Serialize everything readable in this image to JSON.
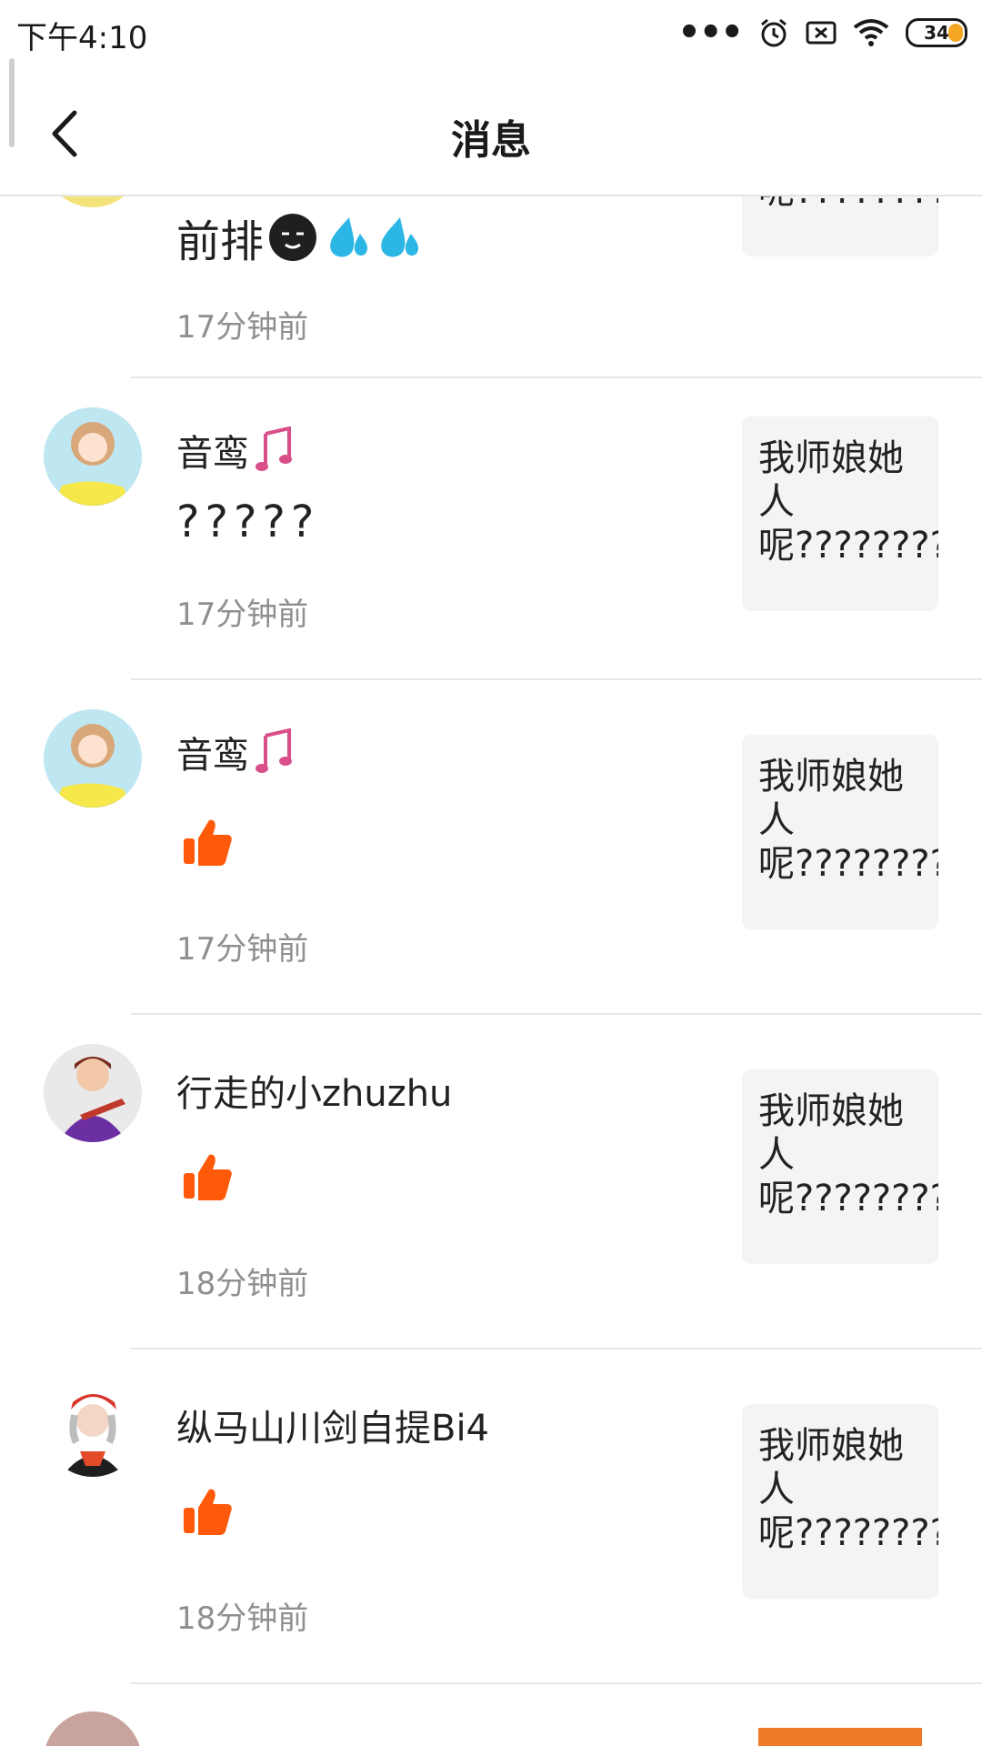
{
  "status_bar": {
    "time": "下午4:10",
    "battery": "34",
    "icons": [
      "more-dots-icon",
      "alarm-icon",
      "sim-off-icon",
      "wifi-icon",
      "battery-icon"
    ]
  },
  "header": {
    "title": "消息",
    "back_icon": "chevron-left-icon"
  },
  "colors": {
    "like": "#ff5a0a",
    "time_text": "#8f8f8f",
    "quote_bg": "#f4f4f4"
  },
  "messages": [
    {
      "name": "",
      "comment": "前排",
      "time": "17分钟前",
      "quote": "我师娘她人呢????????"
    },
    {
      "name": "音鸾",
      "comment": "?????",
      "time": "17分钟前",
      "quote": "我师娘她人呢????????"
    },
    {
      "name": "音鸾",
      "comment": "",
      "time": "17分钟前",
      "quote": "我师娘她人呢????????",
      "like": true
    },
    {
      "name": "行走的小zhuzhu",
      "comment": "",
      "time": "18分钟前",
      "quote": "我师娘她人呢????????",
      "like": true
    },
    {
      "name": "纵马山川剑自提Bi4",
      "comment": "",
      "time": "18分钟前",
      "quote": "我师娘她人呢????????",
      "like": true
    }
  ]
}
